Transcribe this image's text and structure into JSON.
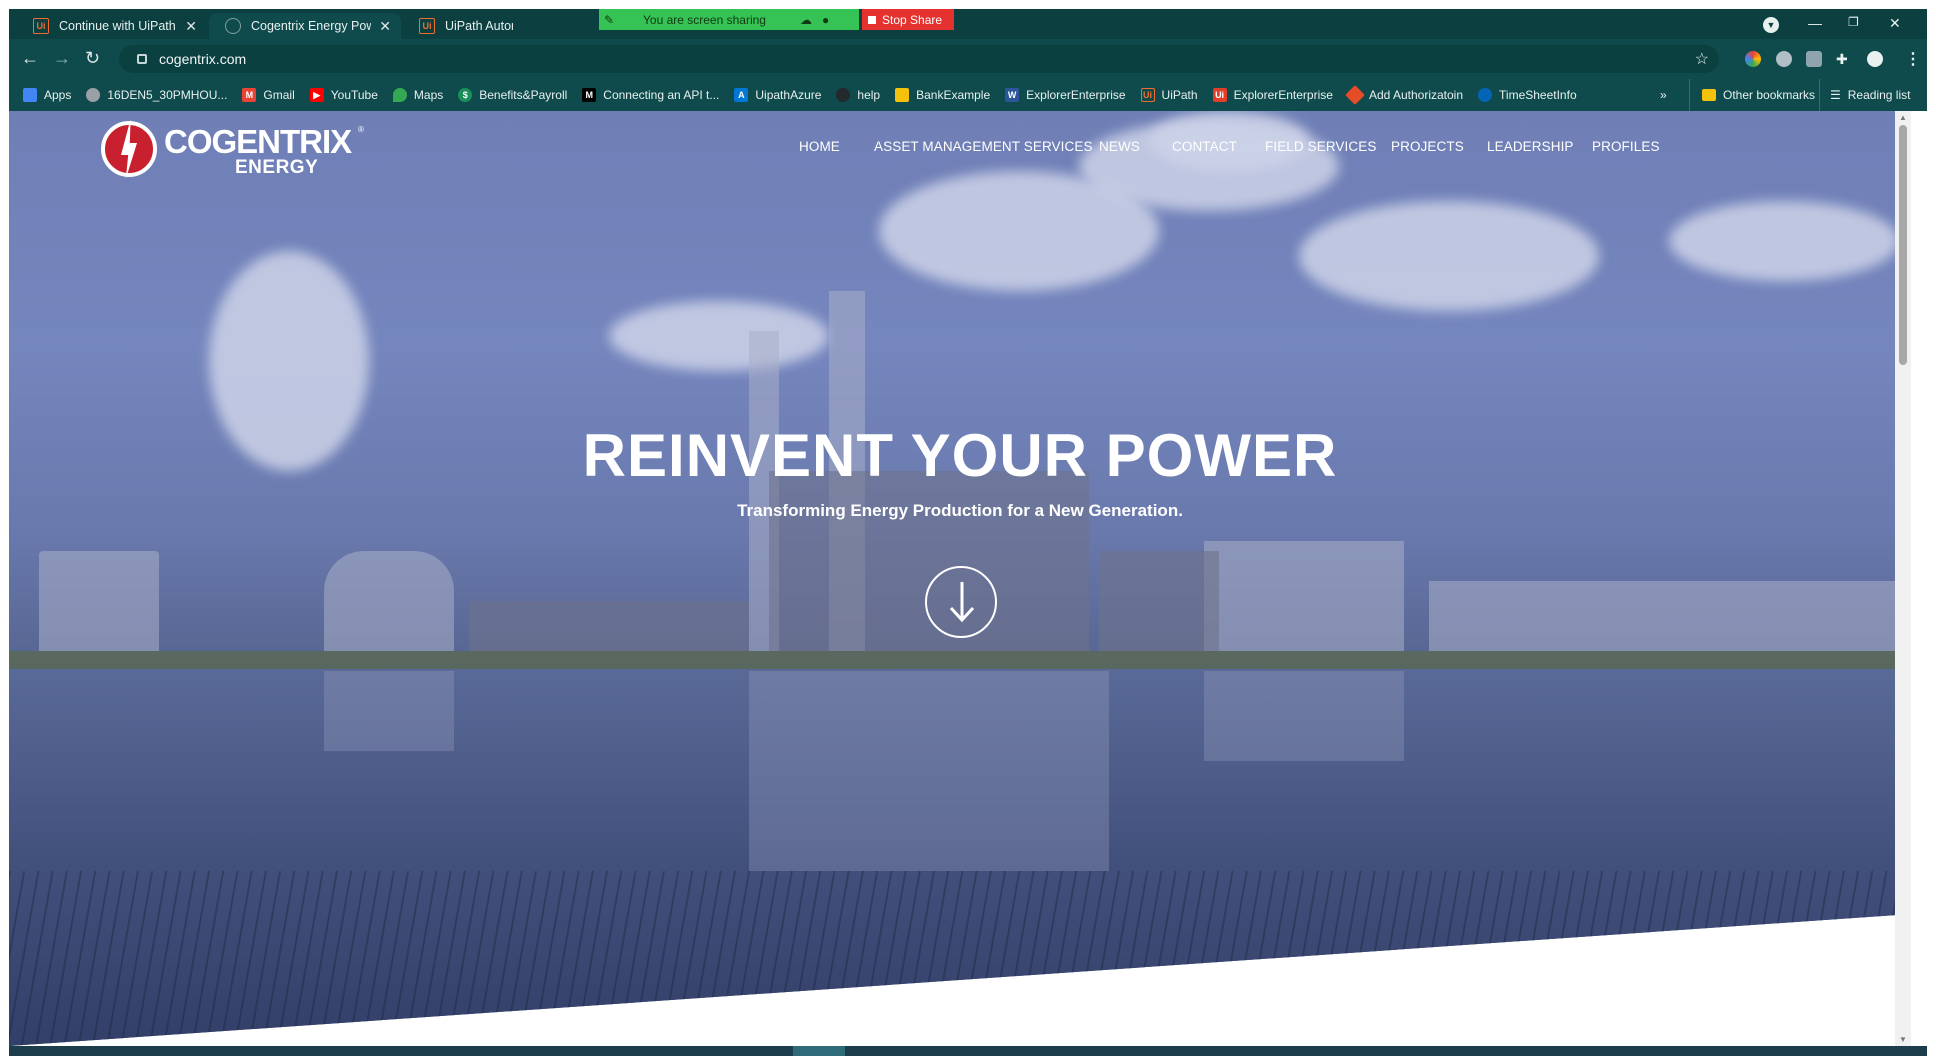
{
  "browser": {
    "tabs": [
      {
        "title": "Continue with UiPath",
        "icon": "uipath-icon",
        "active": false
      },
      {
        "title": "Cogentrix Energy Power Manage",
        "icon": "globe-icon",
        "active": true
      },
      {
        "title": "UiPath Autor",
        "icon": "uipath-icon",
        "active": false
      }
    ],
    "screen_share": {
      "message": "You are screen sharing",
      "stop_label": "Stop Share"
    },
    "address": "cogentrix.com",
    "bookmarks": [
      {
        "label": "Apps",
        "icon": "apps-grid-icon",
        "color": "#4285f4"
      },
      {
        "label": "16DEN5_30PMHOU...",
        "icon": "chrome-icon",
        "color": "#9aa0a6"
      },
      {
        "label": "Gmail",
        "icon": "gmail-icon",
        "color": "#ea4335"
      },
      {
        "label": "YouTube",
        "icon": "youtube-icon",
        "color": "#ff0000"
      },
      {
        "label": "Maps",
        "icon": "maps-pin-icon",
        "color": "#34a853"
      },
      {
        "label": "Benefits&Payroll",
        "icon": "payroll-icon",
        "color": "#1a8f5a"
      },
      {
        "label": "Connecting an API t...",
        "icon": "medium-icon",
        "color": "#000000"
      },
      {
        "label": "UipathAzure",
        "icon": "azure-icon",
        "color": "#0078d4"
      },
      {
        "label": "help",
        "icon": "github-icon",
        "color": "#24292e"
      },
      {
        "label": "BankExample",
        "icon": "bank-icon",
        "color": "#f4c20d"
      },
      {
        "label": "ExplorerEnterprise",
        "icon": "word-icon",
        "color": "#2b579a"
      },
      {
        "label": "UiPath",
        "icon": "uipath-icon",
        "color": "#f26d2c"
      },
      {
        "label": "ExplorerEnterprise",
        "icon": "uipath-icon",
        "color": "#e23d28"
      },
      {
        "label": "Add Authorizatoin",
        "icon": "api-icon",
        "color": "#e44d26"
      },
      {
        "label": "TimeSheetInfo",
        "icon": "onedrive-icon",
        "color": "#0364b8"
      }
    ],
    "more_bookmarks": "»",
    "other_bookmarks": "Other bookmarks",
    "reading_list": "Reading list"
  },
  "site": {
    "logo_word1": "COGENTRIX",
    "logo_word2": "ENERGY",
    "logo_reg": "®",
    "nav": [
      "HOME",
      "ASSET MANAGEMENT SERVICES",
      "NEWS",
      "CONTACT",
      "FIELD SERVICES",
      "PROJECTS",
      "LEADERSHIP",
      "PROFILES"
    ],
    "headline": "REINVENT YOUR POWER",
    "subheadline": "Transforming Energy Production for a New Generation."
  },
  "colors": {
    "chrome": "#0f4b4c",
    "share_green": "#36c356",
    "stop_red": "#e5322f",
    "brand_red": "#c8202e"
  }
}
